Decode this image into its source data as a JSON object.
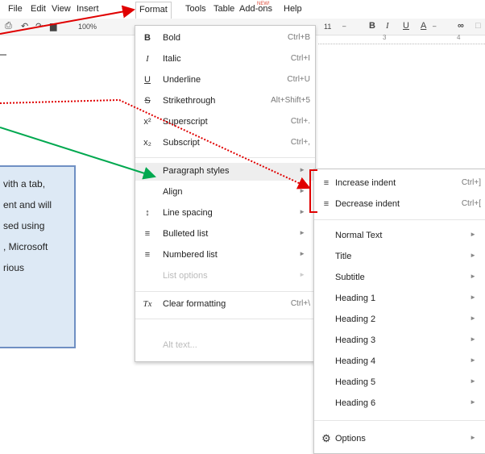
{
  "menubar": {
    "items": [
      "File",
      "Edit",
      "View",
      "Insert",
      "Format",
      "Tools",
      "Table",
      "Add-ons",
      "Help"
    ],
    "new_badge": "NEW!"
  },
  "toolbar": {
    "zoom": "100%",
    "font_size": "11",
    "bold": "B",
    "italic": "I",
    "underline": "U",
    "text_color": "A",
    "ruler_marks": [
      "3",
      "4"
    ]
  },
  "format_menu": {
    "items": [
      {
        "icon": "B",
        "label": "Bold",
        "shortcut": "Ctrl+B"
      },
      {
        "icon": "I",
        "label": "Italic",
        "shortcut": "Ctrl+I"
      },
      {
        "icon": "U",
        "label": "Underline",
        "shortcut": "Ctrl+U"
      },
      {
        "icon": "S",
        "label": "Strikethrough",
        "shortcut": "Alt+Shift+5"
      },
      {
        "icon": "x²",
        "label": "Superscript",
        "shortcut": "Ctrl+."
      },
      {
        "icon": "x₂",
        "label": "Subscript",
        "shortcut": "Ctrl+,"
      },
      {
        "icon": "",
        "label": "Paragraph styles",
        "shortcut": ""
      },
      {
        "icon": "",
        "label": "Align",
        "shortcut": ""
      },
      {
        "icon": "",
        "label": "Line spacing",
        "shortcut": ""
      },
      {
        "icon": "",
        "label": "Bulleted list",
        "shortcut": ""
      },
      {
        "icon": "",
        "label": "Numbered list",
        "shortcut": ""
      },
      {
        "icon": "",
        "label": "List options",
        "shortcut": ""
      },
      {
        "icon": "Tx",
        "label": "Clear formatting",
        "shortcut": "Ctrl+\\"
      },
      {
        "icon": "",
        "label": "Alt text...",
        "shortcut": ""
      }
    ]
  },
  "paragraph_submenu": {
    "items": [
      {
        "label": "Increase indent",
        "shortcut": "Ctrl+]"
      },
      {
        "label": "Decrease indent",
        "shortcut": "Ctrl+["
      },
      {
        "label": "Normal Text"
      },
      {
        "label": "Title"
      },
      {
        "label": "Subtitle"
      },
      {
        "label": "Heading 1"
      },
      {
        "label": "Heading 2"
      },
      {
        "label": "Heading 3"
      },
      {
        "label": "Heading 4"
      },
      {
        "label": "Heading 5"
      },
      {
        "label": "Heading 6"
      },
      {
        "label": "Options"
      }
    ]
  },
  "infobox": {
    "lines": [
      "vith a tab,",
      "ent and will",
      "sed using",
      ", Microsoft",
      "rious"
    ]
  },
  "annotations": {
    "red_color": "#e00000",
    "green_color": "#00a84f"
  }
}
